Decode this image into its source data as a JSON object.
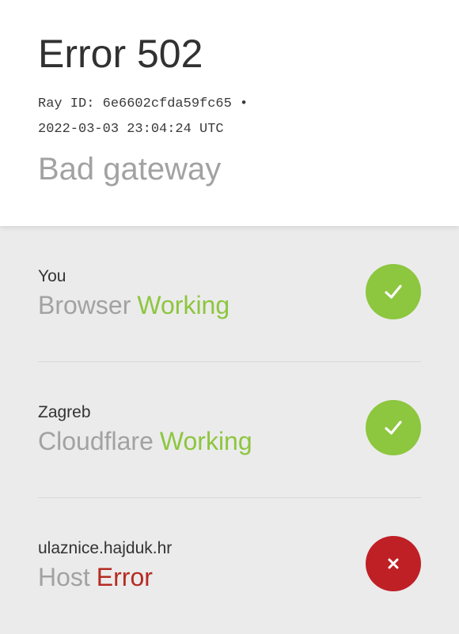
{
  "header": {
    "title": "Error 502",
    "ray_line": "Ray ID: 6e6602cfda59fc65 •",
    "timestamp": "2022-03-03 23:04:24 UTC",
    "subtitle": "Bad gateway"
  },
  "steps": [
    {
      "location": "You",
      "label": "Browser",
      "status": "Working",
      "icon": "check-icon",
      "color": "#8dc63f"
    },
    {
      "location": "Zagreb",
      "label": "Cloudflare",
      "status": "Working",
      "icon": "check-icon",
      "color": "#8dc63f"
    },
    {
      "location": "ulaznice.hajduk.hr",
      "label": "Host",
      "status": "Error",
      "icon": "close-icon",
      "color": "#bf2026"
    }
  ]
}
